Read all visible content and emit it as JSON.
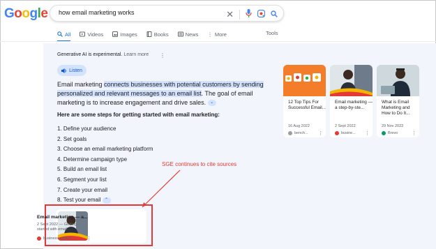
{
  "search": {
    "query": "how email marketing works"
  },
  "tabs": [
    {
      "label": "All"
    },
    {
      "label": "Videos"
    },
    {
      "label": "Images"
    },
    {
      "label": "Books"
    },
    {
      "label": "News"
    },
    {
      "label": "More"
    }
  ],
  "tools_label": "Tools",
  "sge": {
    "notice": "Generative AI is experimental.",
    "learn_more": "Learn more",
    "listen_label": "Listen",
    "summary_p1": "Email marketing ",
    "summary_h1": "connects businesses with potential customers by sending personalized and relevant messages to an email list",
    "summary_p2": ". The goal of email marketing is to increase engagement and drive sales.",
    "steps_heading": "Here are some steps for getting started with email marketing:",
    "steps": [
      "1.  Define your audience",
      "2.  Set goals",
      "3.  Choose an email marketing platform",
      "4.  Determine campaign type",
      "5.  Build an email list",
      "6.  Segment your list",
      "7.  Create your email",
      "8.  Test your email"
    ]
  },
  "cards": [
    {
      "title": "12 Top Tips For Successful Email...",
      "date": "16 Aug 2022",
      "source": "bench...",
      "fav_color": "#9e9e9e"
    },
    {
      "title": "Email marketing — a step-by-ste...",
      "date": "2 Sept 2022",
      "source": "busine...",
      "fav_color": "#e53935"
    },
    {
      "title": "What is Email Marketing and How to Do It...",
      "date": "29 Nov 2023",
      "source": "Brevo",
      "fav_color": "#0b996e"
    }
  ],
  "annotation": {
    "label": "SGE continues to cite sources"
  },
  "cited": {
    "title": "Email marketing — a...",
    "date": "2 Sept 2022 — Getting started with email...",
    "source": "business.adobe...."
  }
}
